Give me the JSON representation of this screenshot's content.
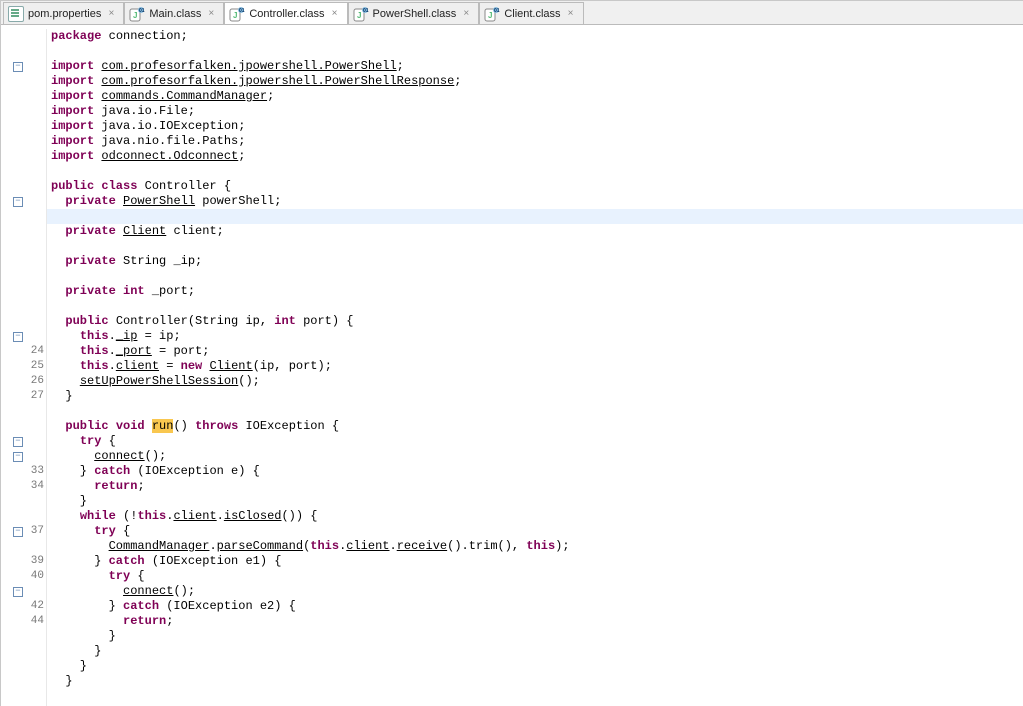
{
  "tabs": [
    {
      "label": "pom.properties",
      "icon": "properties-icon",
      "active": false
    },
    {
      "label": "Main.class",
      "icon": "class-icon",
      "active": false
    },
    {
      "label": "Controller.class",
      "icon": "class-icon",
      "active": true
    },
    {
      "label": "PowerShell.class",
      "icon": "class-icon",
      "active": false
    },
    {
      "label": "Client.class",
      "icon": "class-icon",
      "active": false
    }
  ],
  "fold_minus": "−",
  "close_glyph": "×",
  "gutter_lines": [
    "",
    "",
    "",
    "",
    "",
    "",
    "",
    "",
    "",
    "",
    "",
    "",
    "",
    "",
    "",
    "",
    "",
    "",
    "",
    "",
    "",
    "24",
    "25",
    "26",
    "27",
    "",
    "",
    "",
    "",
    "33",
    "34",
    "",
    "",
    "37",
    "",
    "39",
    "40",
    "",
    "42",
    "44",
    "",
    "",
    "",
    "",
    ""
  ],
  "fold_markers": {
    "2": true,
    "11": true,
    "20": true,
    "27": true,
    "28": true,
    "33": true,
    "37": true
  },
  "code": {
    "l0": {
      "pre": "",
      "kw": "package",
      "post": " connection;"
    },
    "l1": {
      "pre": ""
    },
    "l2": {
      "kw": "import",
      "sp": " ",
      "ul": "com.profesorfalken.jpowershell.PowerShell",
      "sc": ";"
    },
    "l3": {
      "kw": "import",
      "sp": " ",
      "ul": "com.profesorfalken.jpowershell.PowerShellResponse",
      "sc": ";"
    },
    "l4": {
      "kw": "import",
      "sp": " ",
      "ul": "commands.CommandManager",
      "sc": ";"
    },
    "l5": {
      "kw": "import",
      "sp": " ",
      "t": "java.io.File;"
    },
    "l6": {
      "kw": "import",
      "sp": " ",
      "t": "java.io.IOException;"
    },
    "l7": {
      "kw": "import",
      "sp": " ",
      "t": "java.nio.file.Paths;"
    },
    "l8": {
      "kw": "import",
      "sp": " ",
      "ul": "odconnect.Odconnect",
      "sc": ";"
    },
    "l9": {
      "pre": ""
    },
    "l10": {
      "kw": "public class",
      "t": " Controller {"
    },
    "l11": {
      "pre": "  ",
      "kw": "private",
      "sp": " ",
      "ul": "PowerShell",
      "t": " powerShell;"
    },
    "l12": {
      "pre": "  "
    },
    "l13": {
      "pre": "  ",
      "kw": "private",
      "sp": " ",
      "ul": "Client",
      "t": " client;"
    },
    "l14": {
      "pre": "  "
    },
    "l15": {
      "pre": "  ",
      "kw": "private",
      "t": " String _ip;"
    },
    "l16": {
      "pre": "  "
    },
    "l17": {
      "pre": "  ",
      "kw": "private",
      "sp": " ",
      "kw2": "int",
      "t": " _port;"
    },
    "l18": {
      "pre": "  "
    },
    "l19": {
      "pre": "  ",
      "kw": "public",
      "t": " Controller(String ip, ",
      "kw2": "int",
      "t2": " port) {"
    },
    "l20": {
      "pre": "    ",
      "kw": "this",
      "t": ".",
      "ul": "_ip",
      "t2": " = ip;"
    },
    "l21": {
      "pre": "    ",
      "kw": "this",
      "t": ".",
      "ul": "_port",
      "t2": " = port;"
    },
    "l22": {
      "pre": "    ",
      "kw": "this",
      "t": ".",
      "ul": "client",
      "t2": " = ",
      "kw2": "new",
      "sp": " ",
      "ul2": "Client",
      "t3": "(ip, port);"
    },
    "l23": {
      "pre": "    ",
      "ul": "setUpPowerShellSession",
      "t": "();"
    },
    "l24": {
      "pre": "  }",
      "t": ""
    },
    "l25": {
      "pre": "  "
    },
    "l26": {
      "pre": "  ",
      "kw": "public",
      "sp": " ",
      "kw2": "void",
      "sp2": " ",
      "mark": "run",
      "t": "() ",
      "kw3": "throws",
      "t2": " IOException {"
    },
    "l27": {
      "pre": "    ",
      "kw": "try",
      "t": " {"
    },
    "l28": {
      "pre": "      ",
      "ul": "connect",
      "t": "();"
    },
    "l29": {
      "pre": "    } ",
      "kw": "catch",
      "t": " (IOException e) {"
    },
    "l30": {
      "pre": "      ",
      "kw": "return",
      "t": ";"
    },
    "l31": {
      "pre": "    }"
    },
    "l32": {
      "pre": "    ",
      "kw": "while",
      "t": " (!",
      "kw2": "this",
      "t2": ".",
      "ul": "client",
      "t3": ".",
      "ul2": "isClosed",
      "t4": "()) {"
    },
    "l33": {
      "pre": "      ",
      "kw": "try",
      "t": " {"
    },
    "l34": {
      "pre": "        ",
      "ul": "CommandManager",
      "t": ".",
      "ul2": "parseCommand",
      "t2": "(",
      "kw": "this",
      "t3": ".",
      "ul3": "client",
      "t4": ".",
      "ul4": "receive",
      "t5": "().trim(), ",
      "kw2": "this",
      "t6": ");"
    },
    "l35": {
      "pre": "      } ",
      "kw": "catch",
      "t": " (IOException e1) {"
    },
    "l36": {
      "pre": "        ",
      "kw": "try",
      "t": " {"
    },
    "l37": {
      "pre": "          ",
      "ul": "connect",
      "t": "();"
    },
    "l38": {
      "pre": "        } ",
      "kw": "catch",
      "t": " (IOException e2) {"
    },
    "l39": {
      "pre": "          ",
      "kw": "return",
      "t": ";"
    },
    "l40": {
      "pre": "        }"
    },
    "l41": {
      "pre": "      }"
    },
    "l42": {
      "pre": "    }"
    },
    "l43": {
      "pre": "  }"
    }
  }
}
